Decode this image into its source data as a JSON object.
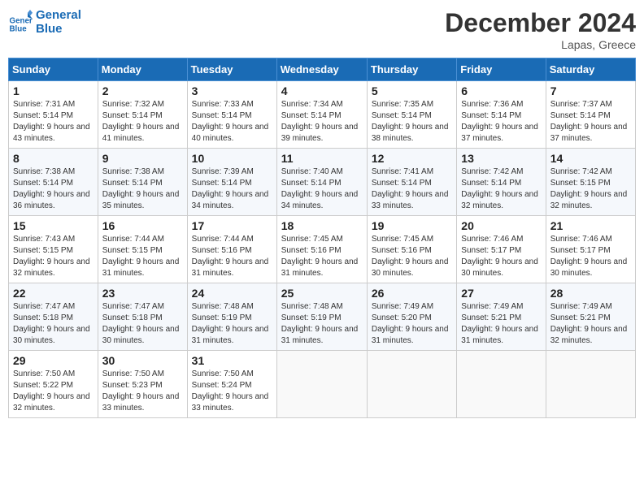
{
  "header": {
    "logo_line1": "General",
    "logo_line2": "Blue",
    "month_year": "December 2024",
    "location": "Lapas, Greece"
  },
  "weekdays": [
    "Sunday",
    "Monday",
    "Tuesday",
    "Wednesday",
    "Thursday",
    "Friday",
    "Saturday"
  ],
  "weeks": [
    [
      {
        "day": "1",
        "sunrise": "7:31 AM",
        "sunset": "5:14 PM",
        "daylight": "9 hours and 43 minutes."
      },
      {
        "day": "2",
        "sunrise": "7:32 AM",
        "sunset": "5:14 PM",
        "daylight": "9 hours and 41 minutes."
      },
      {
        "day": "3",
        "sunrise": "7:33 AM",
        "sunset": "5:14 PM",
        "daylight": "9 hours and 40 minutes."
      },
      {
        "day": "4",
        "sunrise": "7:34 AM",
        "sunset": "5:14 PM",
        "daylight": "9 hours and 39 minutes."
      },
      {
        "day": "5",
        "sunrise": "7:35 AM",
        "sunset": "5:14 PM",
        "daylight": "9 hours and 38 minutes."
      },
      {
        "day": "6",
        "sunrise": "7:36 AM",
        "sunset": "5:14 PM",
        "daylight": "9 hours and 37 minutes."
      },
      {
        "day": "7",
        "sunrise": "7:37 AM",
        "sunset": "5:14 PM",
        "daylight": "9 hours and 37 minutes."
      }
    ],
    [
      {
        "day": "8",
        "sunrise": "7:38 AM",
        "sunset": "5:14 PM",
        "daylight": "9 hours and 36 minutes."
      },
      {
        "day": "9",
        "sunrise": "7:38 AM",
        "sunset": "5:14 PM",
        "daylight": "9 hours and 35 minutes."
      },
      {
        "day": "10",
        "sunrise": "7:39 AM",
        "sunset": "5:14 PM",
        "daylight": "9 hours and 34 minutes."
      },
      {
        "day": "11",
        "sunrise": "7:40 AM",
        "sunset": "5:14 PM",
        "daylight": "9 hours and 34 minutes."
      },
      {
        "day": "12",
        "sunrise": "7:41 AM",
        "sunset": "5:14 PM",
        "daylight": "9 hours and 33 minutes."
      },
      {
        "day": "13",
        "sunrise": "7:42 AM",
        "sunset": "5:14 PM",
        "daylight": "9 hours and 32 minutes."
      },
      {
        "day": "14",
        "sunrise": "7:42 AM",
        "sunset": "5:15 PM",
        "daylight": "9 hours and 32 minutes."
      }
    ],
    [
      {
        "day": "15",
        "sunrise": "7:43 AM",
        "sunset": "5:15 PM",
        "daylight": "9 hours and 32 minutes."
      },
      {
        "day": "16",
        "sunrise": "7:44 AM",
        "sunset": "5:15 PM",
        "daylight": "9 hours and 31 minutes."
      },
      {
        "day": "17",
        "sunrise": "7:44 AM",
        "sunset": "5:16 PM",
        "daylight": "9 hours and 31 minutes."
      },
      {
        "day": "18",
        "sunrise": "7:45 AM",
        "sunset": "5:16 PM",
        "daylight": "9 hours and 31 minutes."
      },
      {
        "day": "19",
        "sunrise": "7:45 AM",
        "sunset": "5:16 PM",
        "daylight": "9 hours and 30 minutes."
      },
      {
        "day": "20",
        "sunrise": "7:46 AM",
        "sunset": "5:17 PM",
        "daylight": "9 hours and 30 minutes."
      },
      {
        "day": "21",
        "sunrise": "7:46 AM",
        "sunset": "5:17 PM",
        "daylight": "9 hours and 30 minutes."
      }
    ],
    [
      {
        "day": "22",
        "sunrise": "7:47 AM",
        "sunset": "5:18 PM",
        "daylight": "9 hours and 30 minutes."
      },
      {
        "day": "23",
        "sunrise": "7:47 AM",
        "sunset": "5:18 PM",
        "daylight": "9 hours and 30 minutes."
      },
      {
        "day": "24",
        "sunrise": "7:48 AM",
        "sunset": "5:19 PM",
        "daylight": "9 hours and 31 minutes."
      },
      {
        "day": "25",
        "sunrise": "7:48 AM",
        "sunset": "5:19 PM",
        "daylight": "9 hours and 31 minutes."
      },
      {
        "day": "26",
        "sunrise": "7:49 AM",
        "sunset": "5:20 PM",
        "daylight": "9 hours and 31 minutes."
      },
      {
        "day": "27",
        "sunrise": "7:49 AM",
        "sunset": "5:21 PM",
        "daylight": "9 hours and 31 minutes."
      },
      {
        "day": "28",
        "sunrise": "7:49 AM",
        "sunset": "5:21 PM",
        "daylight": "9 hours and 32 minutes."
      }
    ],
    [
      {
        "day": "29",
        "sunrise": "7:50 AM",
        "sunset": "5:22 PM",
        "daylight": "9 hours and 32 minutes."
      },
      {
        "day": "30",
        "sunrise": "7:50 AM",
        "sunset": "5:23 PM",
        "daylight": "9 hours and 33 minutes."
      },
      {
        "day": "31",
        "sunrise": "7:50 AM",
        "sunset": "5:24 PM",
        "daylight": "9 hours and 33 minutes."
      },
      null,
      null,
      null,
      null
    ]
  ]
}
